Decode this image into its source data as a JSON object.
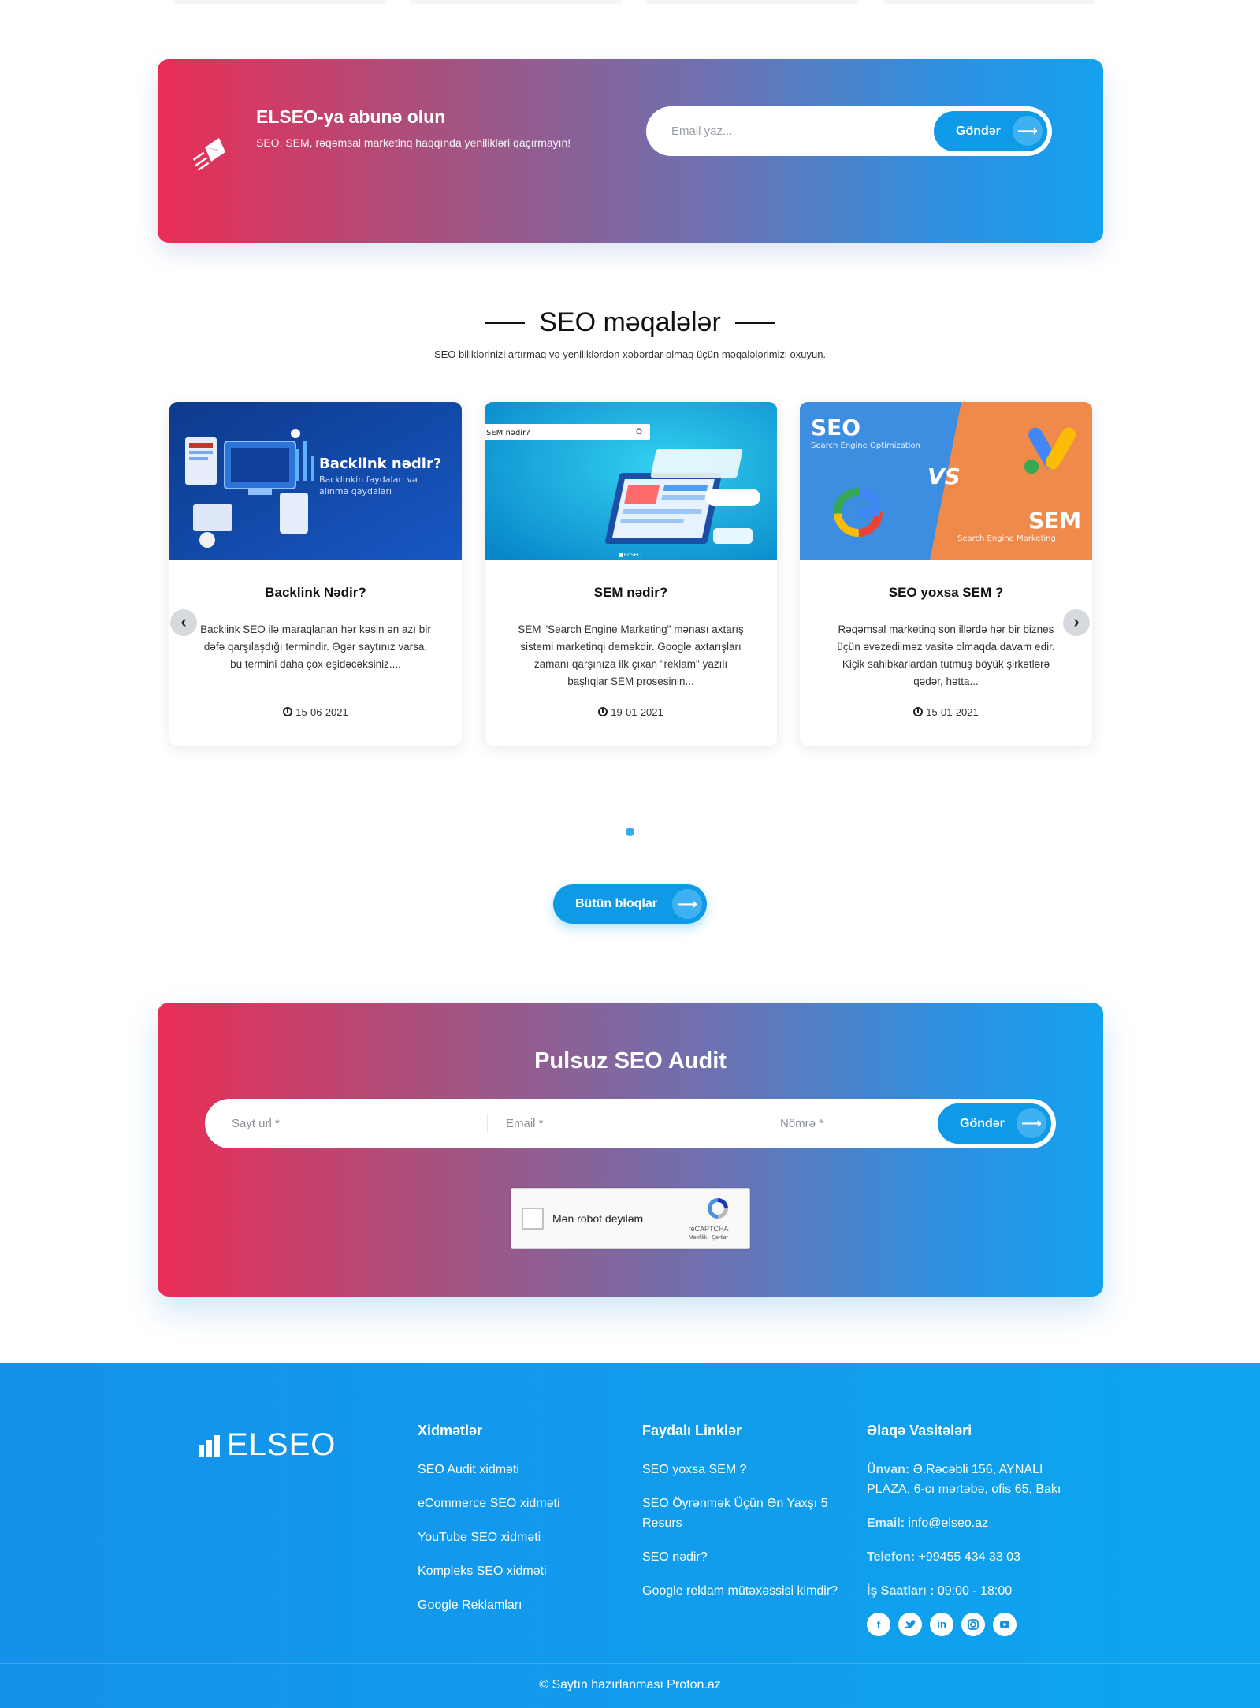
{
  "subscribe": {
    "title": "ELSEO-ya abunə olun",
    "subtitle": "SEO, SEM, rəqəmsal marketinq haqqında yenilikləri qaçırmayın!",
    "email_placeholder": "Email yaz...",
    "button_label": "Göndər"
  },
  "articles": {
    "title": "SEO məqalələr",
    "subtitle": "SEO biliklərinizi artırmaq və yeniliklərdən xəbərdar olmaq üçün məqalələrimizi oxuyun.",
    "cards": [
      {
        "image_title": "Backlink nədir?",
        "image_sub1": "Backlinkin faydaları və",
        "image_sub2": "alınma qaydaları",
        "title": "Backlink Nədir?",
        "excerpt": "Backlink SEO ilə maraqlanan hər kəsin ən azı bir dəfə qarşılaşdığı termindir. Əgər saytınız varsa, bu termini daha çox eşidəcəksiniz....",
        "date": "15-06-2021"
      },
      {
        "image_search_text": "SEM nədir?",
        "image_brand": "■ELSEO",
        "title": "SEM nədir?",
        "excerpt": "SEM \"Search Engine Marketing\" mənası axtarış sistemi marketinqi deməkdir. Google axtarışları zamanı qarşınıza ilk çıxan \"reklam\" yazılı başlıqlar SEM prosesinin...",
        "date": "19-01-2021"
      },
      {
        "image_left": "SEO",
        "image_left_sub": "Search Engine Optimization",
        "image_vs": "VS",
        "image_right": "SEM",
        "image_right_sub": "Search Engine Marketing",
        "title": "SEO yoxsa SEM ?",
        "excerpt": "Rəqəmsal marketinq son illərdə hər bir biznes üçün əvəzedilməz vasitə olmaqda davam edir. Kiçik sahibkarlardan tutmuş böyük şirkətlərə qədər, hətta...",
        "date": "15-01-2021"
      }
    ],
    "all_button": "Bütün bloqlar"
  },
  "audit": {
    "title": "Pulsuz SEO Audit",
    "url_placeholder": "Sayt url *",
    "email_placeholder": "Email *",
    "phone_placeholder": "Nömrə *",
    "button_label": "Göndər",
    "captcha_label": "Mən robot deyiləm",
    "captcha_brand": "reCAPTCHA",
    "captcha_links": "Məxfilik - Şərtlər"
  },
  "footer": {
    "logo": "ELSEO",
    "services": {
      "title": "Xidmətlər",
      "items": [
        "SEO Audit xidməti",
        "eCommerce SEO xidməti",
        "YouTube SEO xidməti",
        "Kompleks SEO xidməti",
        "Google Reklamları"
      ]
    },
    "useful": {
      "title": "Faydalı Linklər",
      "items": [
        "SEO yoxsa SEM ?",
        "SEO Öyrənmək Üçün Ən Yaxşı 5 Resurs",
        "SEO nədir?",
        "Google reklam mütəxəssisi kimdir?"
      ]
    },
    "contact": {
      "title": "Əlaqə Vasitələri",
      "address_label": "Ünvan:",
      "address": "Ə.Rəcəbli 156, AYNALI PLAZA, 6-cı mərtəbə, ofis 65, Bakı",
      "email_label": "Email:",
      "email": "info@elseo.az",
      "phone_label": "Telefon:",
      "phone": "+99455 434 33 03",
      "hours_label": "İş Saatları :",
      "hours": "09:00 - 18:00"
    },
    "social": [
      "facebook-icon",
      "twitter-icon",
      "linkedin-icon",
      "instagram-icon",
      "youtube-icon"
    ],
    "copyright": "© Saytın hazırlanması Proton.az"
  },
  "colors": {
    "gradient_start": "#ea2d55",
    "gradient_end": "#13a2ee",
    "accent": "#0f9ae8",
    "footer": "#1391ea"
  }
}
